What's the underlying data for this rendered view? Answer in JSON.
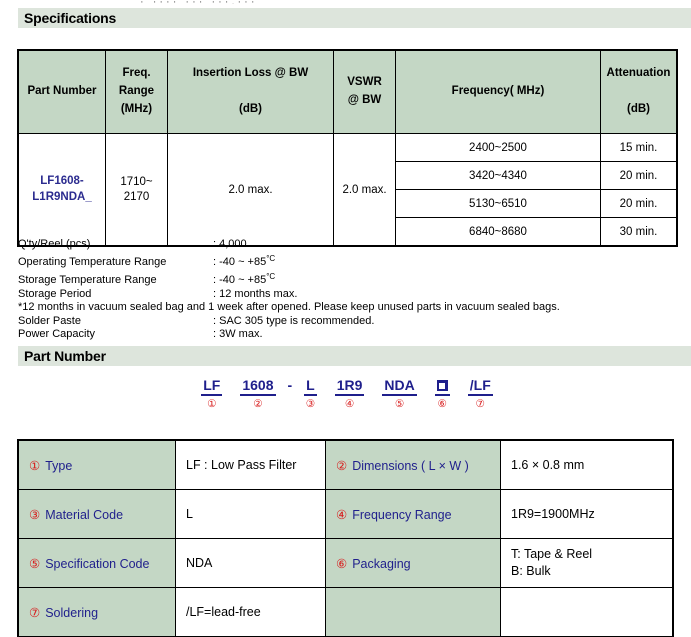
{
  "cut_top_text": "· ···· ··· ···,···",
  "sections": {
    "specifications_title": "Specifications",
    "part_number_title": "Part Number"
  },
  "spec_table": {
    "headers": {
      "part_number": "Part Number",
      "freq_range_l1": "Freq.",
      "freq_range_l2": "Range",
      "freq_range_l3": "(MHz)",
      "insertion_loss_l1": "Insertion Loss @ BW",
      "insertion_loss_l2": "(dB)",
      "vswr_l1": "VSWR",
      "vswr_l2": "@ BW",
      "frequency": "Frequency( MHz)",
      "attenuation_l1": "Attenuation",
      "attenuation_l2": "(dB)"
    },
    "row": {
      "part_number_l1": "LF1608-",
      "part_number_l2": "L1R9NDA_",
      "freq_range_l1": "1710~",
      "freq_range_l2": "2170",
      "insertion_loss": "2.0 max.",
      "vswr": "2.0 max."
    },
    "attenuation_bands": [
      {
        "frequency": "2400~2500",
        "attenuation": "15 min."
      },
      {
        "frequency": "3420~4340",
        "attenuation": "20 min."
      },
      {
        "frequency": "5130~6510",
        "attenuation": "20 min."
      },
      {
        "frequency": "6840~8680",
        "attenuation": "30 min."
      }
    ]
  },
  "notes": {
    "qty_reel_label": "Q'ty/Reel (pcs)",
    "qty_reel_value": ": 4,000",
    "operating_temp_label": "Operating Temperature Range",
    "operating_temp_value": ": -40 ~ +85",
    "storage_temp_label": "Storage Temperature Range",
    "storage_temp_value": ": -40 ~ +85",
    "temp_unit": "°C",
    "storage_period_label": "Storage Period",
    "storage_period_value": ": 12 months max.",
    "vacuum_note": "*12 months in vacuum sealed bag and 1 week after opened. Please keep unused parts in vacuum sealed bags.",
    "solder_paste_label": "Solder Paste",
    "solder_paste_value": ": SAC 305 type is recommended.",
    "power_capacity_label": "Power Capacity",
    "power_capacity_value": ": 3W max."
  },
  "part_number_breakdown": {
    "segments": [
      {
        "code": "LF",
        "index": "①"
      },
      {
        "code": "1608",
        "index": "②"
      },
      {
        "code": "L",
        "index": "③"
      },
      {
        "code": "1R9",
        "index": "④"
      },
      {
        "code": "NDA",
        "index": "⑤"
      },
      {
        "code": "",
        "index": "⑥",
        "glyph": "square-icon"
      },
      {
        "code": "/LF",
        "index": "⑦"
      }
    ],
    "separator": "-"
  },
  "legend_table": {
    "rows": [
      {
        "left_index": "①",
        "left_key": "Type",
        "left_value": "LF : Low Pass Filter",
        "right_index": "②",
        "right_key": "Dimensions ( L × W )",
        "right_value": "1.6 × 0.8 mm"
      },
      {
        "left_index": "③",
        "left_key": "Material Code",
        "left_value": "L",
        "right_index": "④",
        "right_key": "Frequency Range",
        "right_value": "1R9=1900MHz"
      },
      {
        "left_index": "⑤",
        "left_key": "Specification Code",
        "left_value": "NDA",
        "right_index": "⑥",
        "right_key": "Packaging",
        "right_value_l1": "T: Tape & Reel",
        "right_value_l2": "B: Bulk"
      },
      {
        "left_index": "⑦",
        "left_key": "Soldering",
        "left_value": "/LF=lead-free",
        "right_index": "",
        "right_key": "",
        "right_value": ""
      }
    ]
  },
  "colors": {
    "header_green": "#c4d7c5",
    "band_green": "#dde5dc",
    "part_blue": "#1f1f8c",
    "index_red": "#d81d1d"
  }
}
